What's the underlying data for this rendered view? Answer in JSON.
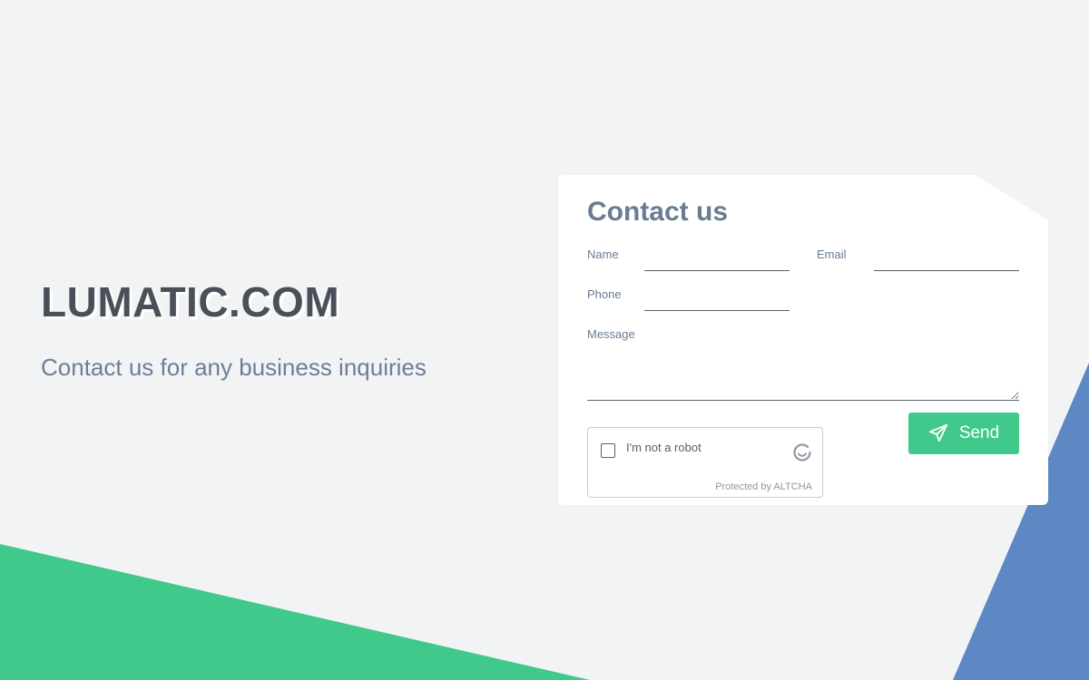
{
  "brand": "LUMATIC.COM",
  "tagline": "Contact us for any business inquiries",
  "form": {
    "title": "Contact us",
    "name_label": "Name",
    "email_label": "Email",
    "phone_label": "Phone",
    "message_label": "Message",
    "send_label": "Send"
  },
  "captcha": {
    "label": "I'm not a robot",
    "protected": "Protected by ALTCHA"
  },
  "colors": {
    "accent_green": "#41c98b",
    "accent_blue": "#5e88c3",
    "text_muted": "#6a7c93",
    "background": "#f2f3f5"
  },
  "icons": {
    "send": "paper-plane-icon",
    "captcha": "altcha-refresh-icon"
  }
}
